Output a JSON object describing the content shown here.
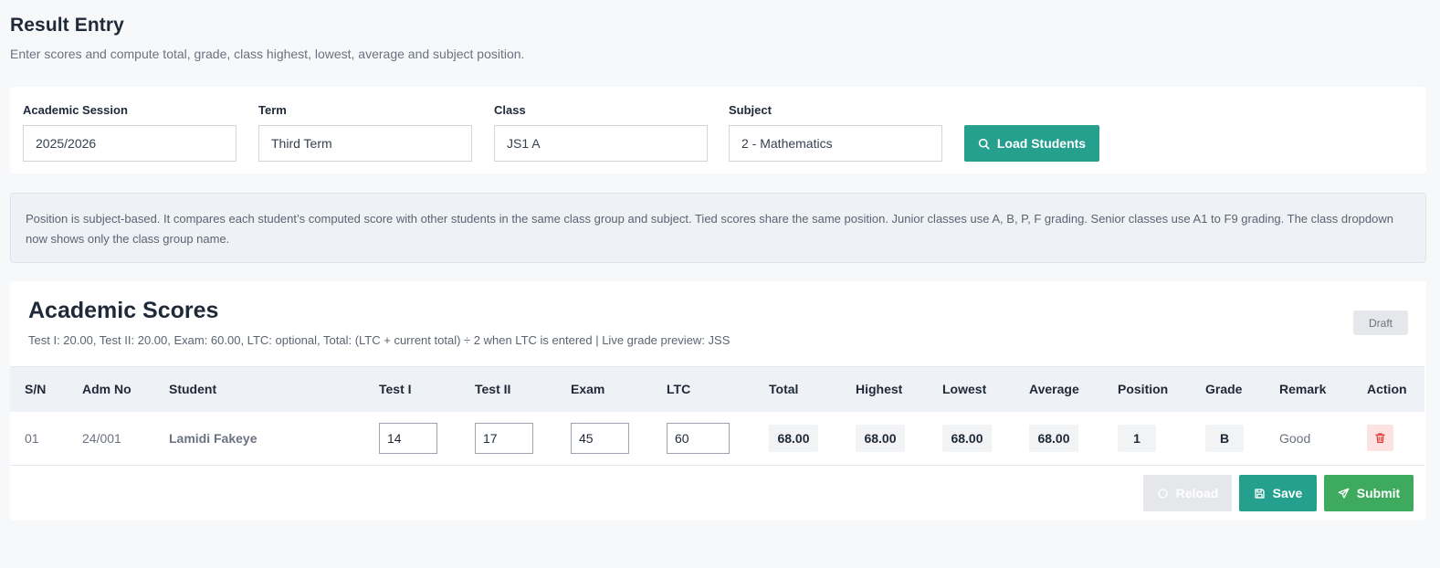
{
  "page": {
    "title": "Result Entry",
    "subtitle": "Enter scores and compute total, grade, class highest, lowest, average and subject position."
  },
  "filters": {
    "session": {
      "label": "Academic Session",
      "value": "2025/2026"
    },
    "term": {
      "label": "Term",
      "value": "Third Term"
    },
    "class": {
      "label": "Class",
      "value": "JS1 A"
    },
    "subject": {
      "label": "Subject",
      "value": "2 - Mathematics"
    },
    "load_button": {
      "label": "Load Students",
      "icon": "search-icon"
    }
  },
  "info": {
    "text": "Position is subject-based. It compares each student’s computed score with other students in the same class group and subject. Tied scores share the same position. Junior classes use A, B, P, F grading. Senior classes use A1 to F9 grading. The class dropdown now shows only the class group name."
  },
  "scores": {
    "title": "Academic Scores",
    "note": "Test I: 20.00, Test II: 20.00, Exam: 60.00, LTC: optional, Total: (LTC + current total) ÷ 2 when LTC is entered | Live grade preview: JSS",
    "status_badge": "Draft",
    "columns": [
      "S/N",
      "Adm No",
      "Student",
      "Test I",
      "Test II",
      "Exam",
      "LTC",
      "Total",
      "Highest",
      "Lowest",
      "Average",
      "Position",
      "Grade",
      "Remark",
      "Action"
    ],
    "rows": [
      {
        "sn": "01",
        "adm_no": "24/001",
        "student": "Lamidi Fakeye",
        "test1": "14",
        "test2": "17",
        "exam": "45",
        "ltc": "60",
        "total": "68.00",
        "highest": "68.00",
        "lowest": "68.00",
        "average": "68.00",
        "position": "1",
        "grade": "B",
        "remark": "Good",
        "action_icon": "trash-icon"
      }
    ]
  },
  "actions": {
    "reload": {
      "label": "Reload",
      "icon": "circle-icon"
    },
    "save": {
      "label": "Save",
      "icon": "floppy-disk-icon"
    },
    "submit": {
      "label": "Submit",
      "icon": "send-icon"
    }
  },
  "colors": {
    "primary": "#26a08e",
    "success": "#3daa5e",
    "danger": "#e53935",
    "danger_bg": "#fde2e2",
    "info_bg": "#eef1f6"
  }
}
